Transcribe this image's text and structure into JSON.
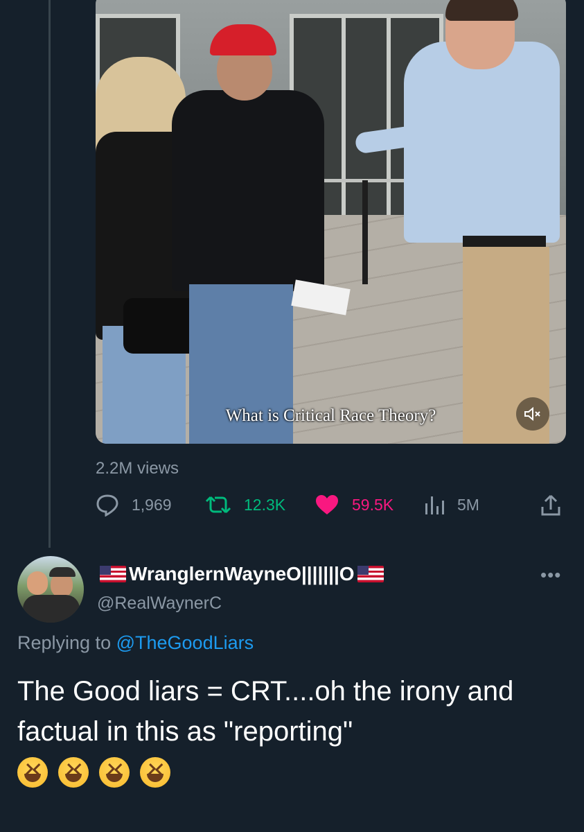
{
  "video": {
    "subtitle": "What is Critical Race Theory?",
    "views": "2.2M views"
  },
  "actions": {
    "replies": "1,969",
    "retweets": "12.3K",
    "likes": "59.5K",
    "impressions": "5M"
  },
  "colors": {
    "background": "#15202b",
    "secondary_text": "#8b98a5",
    "retweet": "#00ba7c",
    "like": "#f91880",
    "link": "#1d9bf0"
  },
  "icons": [
    "reply-icon",
    "retweet-icon",
    "like-icon",
    "views-icon",
    "share-icon",
    "mute-icon",
    "more-icon"
  ],
  "reply": {
    "display_name": "WranglernWayneO|||||||O",
    "handle": "@RealWaynerC",
    "more": "•••",
    "replying_prefix": "Replying to",
    "replying_to": "@TheGoodLiars",
    "text": "The Good liars = CRT....oh the irony and factual in this as \"reporting\""
  }
}
